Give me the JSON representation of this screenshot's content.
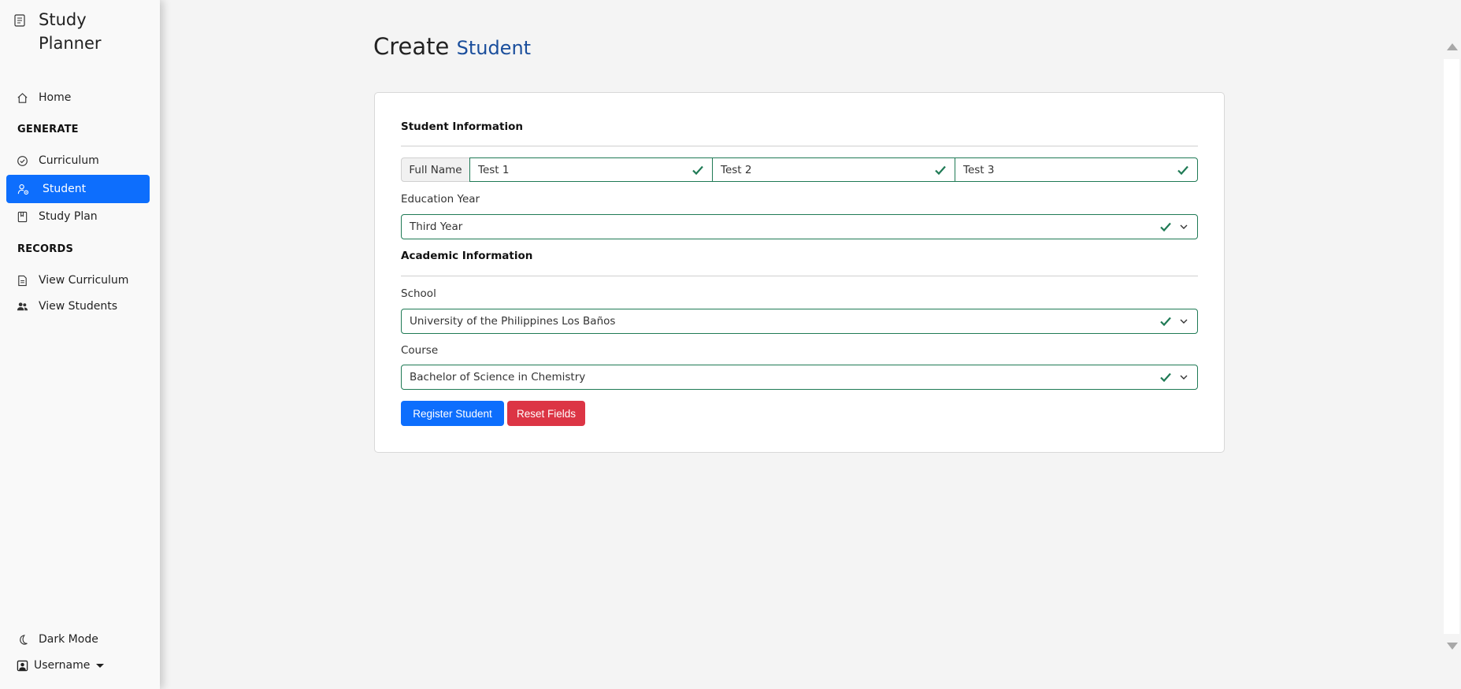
{
  "sidebar": {
    "brand": "Study Planner",
    "home": "Home",
    "generate_heading": "GENERATE",
    "curriculum": "Curriculum",
    "student": "Student",
    "study_plan": "Study Plan",
    "records_heading": "RECORDS",
    "view_curriculum": "View Curriculum",
    "view_students": "View Students",
    "dark_mode": "Dark Mode",
    "username": "Username"
  },
  "page": {
    "title_main": "Create",
    "title_accent": "Student"
  },
  "form": {
    "student_info_title": "Student Information",
    "full_name_label": "Full Name",
    "name_fields": [
      "Test 1",
      "Test 2",
      "Test 3"
    ],
    "education_year_label": "Education Year",
    "education_year_value": "Third Year",
    "academic_info_title": "Academic Information",
    "school_label": "School",
    "school_value": "University of the Philippines Los Baños",
    "course_label": "Course",
    "course_value": "Bachelor of Science in Chemistry",
    "register_button": "Register Student",
    "reset_button": "Reset Fields"
  },
  "colors": {
    "primary": "#0d6efd",
    "danger": "#dc3545",
    "valid": "#1f7a55",
    "accent_title": "#1a4e9c"
  }
}
